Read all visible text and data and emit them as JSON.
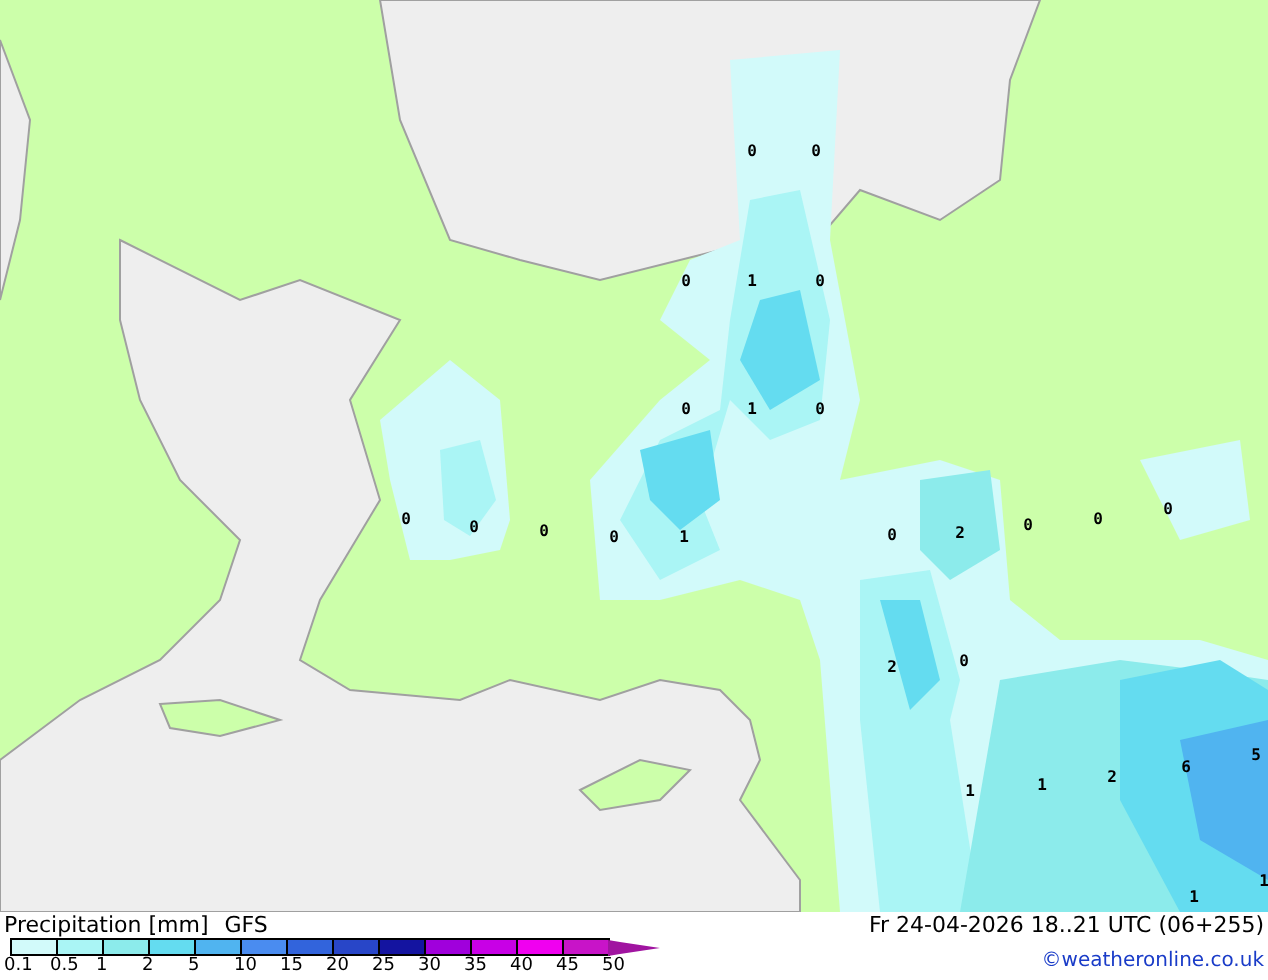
{
  "map": {
    "values": [
      {
        "text": "0"
      },
      {
        "text": "0"
      },
      {
        "text": "0"
      },
      {
        "text": "1"
      },
      {
        "text": "0"
      },
      {
        "text": "0"
      },
      {
        "text": "1"
      },
      {
        "text": "0"
      },
      {
        "text": "0"
      },
      {
        "text": "0"
      },
      {
        "text": "0"
      },
      {
        "text": "0"
      },
      {
        "text": "1"
      },
      {
        "text": "0"
      },
      {
        "text": "2"
      },
      {
        "text": "0"
      },
      {
        "text": "0"
      },
      {
        "text": "0"
      },
      {
        "text": "2"
      },
      {
        "text": "0"
      },
      {
        "text": "1"
      },
      {
        "text": "1"
      },
      {
        "text": "2"
      },
      {
        "text": "6"
      },
      {
        "text": "5"
      },
      {
        "text": "1"
      },
      {
        "text": "1"
      }
    ]
  },
  "legend": {
    "title": "Precipitation [mm]",
    "model": "GFS",
    "valid_time": "Fr 24-04-2026 18..21 UTC (06+255)",
    "credit": "©weatheronline.co.uk",
    "scale": [
      {
        "label": "0.1",
        "color": "#d2fafa"
      },
      {
        "label": "0.5",
        "color": "#aaf5f5"
      },
      {
        "label": "1",
        "color": "#8cebeb"
      },
      {
        "label": "2",
        "color": "#64dcf0"
      },
      {
        "label": "5",
        "color": "#50b4f0"
      },
      {
        "label": "10",
        "color": "#4a8cf0"
      },
      {
        "label": "15",
        "color": "#3264dc"
      },
      {
        "label": "20",
        "color": "#2846c8"
      },
      {
        "label": "25",
        "color": "#1414a0"
      },
      {
        "label": "30",
        "color": "#a000dc"
      },
      {
        "label": "35",
        "color": "#c800e6"
      },
      {
        "label": "40",
        "color": "#f000f0"
      },
      {
        "label": "45",
        "color": "#c814c8"
      },
      {
        "label": "50",
        "color": "#a014a0"
      }
    ]
  }
}
